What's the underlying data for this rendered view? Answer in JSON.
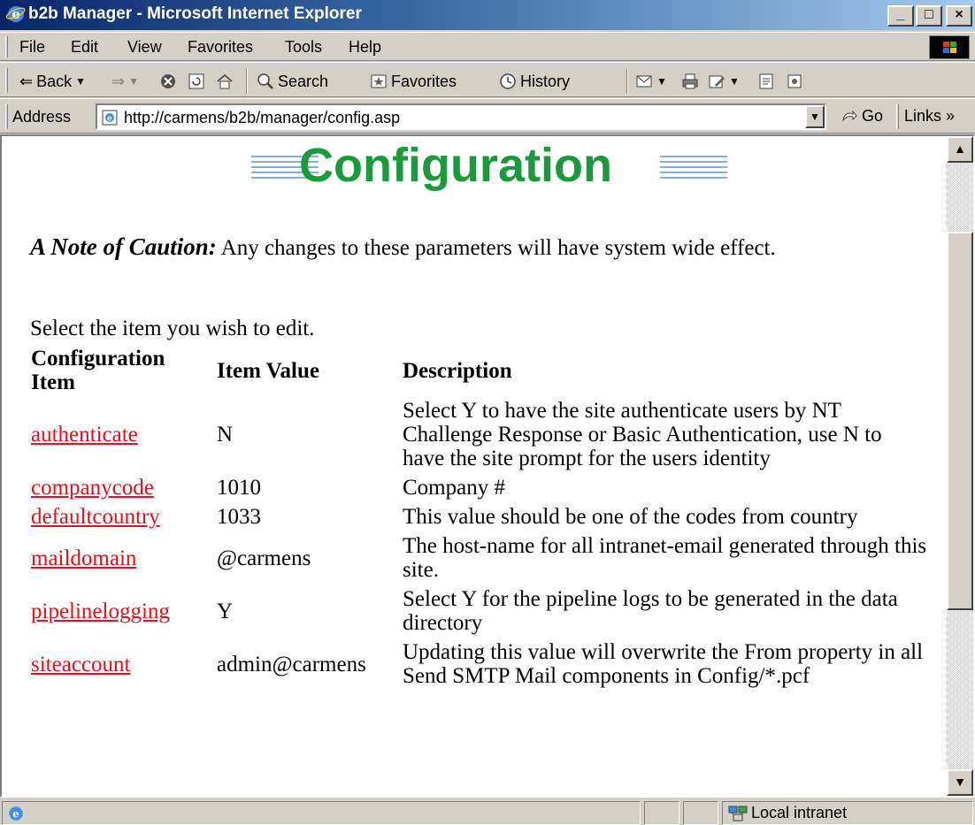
{
  "window": {
    "title": "b2b Manager - Microsoft Internet Explorer",
    "minimize_label": "_",
    "maximize_label": "□",
    "close_label": "×"
  },
  "menu": [
    "File",
    "Edit",
    "View",
    "Favorites",
    "Tools",
    "Help"
  ],
  "toolbar": {
    "back_label": "Back",
    "search_label": "Search",
    "favorites_label": "Favorites",
    "history_label": "History"
  },
  "address": {
    "label": "Address",
    "url": "http://carmens/b2b/manager/config.asp",
    "go_label": "Go",
    "links_label": "Links »"
  },
  "page": {
    "banner_title": "Configuration",
    "caution_heading": "A Note of Caution:",
    "caution_text": " Any changes to these parameters will have system wide effect.",
    "select_note": "Select the item you wish to edit.",
    "table": {
      "headers": [
        "Configuration Item",
        "Item Value",
        "Description"
      ],
      "rows": [
        {
          "item": "authenticate",
          "value": "N",
          "description": "Select Y to have the site authenticate users by NT Challenge Response or Basic Authentication, use N to have the site prompt for the users identity"
        },
        {
          "item": "companycode",
          "value": "1010",
          "description": "Company #"
        },
        {
          "item": "defaultcountry",
          "value": "1033",
          "description": "This value should be one of the codes from country"
        },
        {
          "item": "maildomain",
          "value": "@carmens",
          "description": "The host-name for all intranet-email generated through this site."
        },
        {
          "item": "pipelinelogging",
          "value": "Y",
          "description": "Select Y for the pipeline logs to be generated in the data directory"
        },
        {
          "item": "siteaccount",
          "value": "admin@carmens",
          "description": "Updating this value will overwrite the From property in all Send SMTP Mail components in Config/*.pcf"
        }
      ]
    }
  },
  "status": {
    "zone_label": "Local intranet"
  },
  "colors": {
    "link": "#e8101a",
    "banner_green": "#1a9a3a",
    "titlebar_dark": "#0a246a"
  }
}
